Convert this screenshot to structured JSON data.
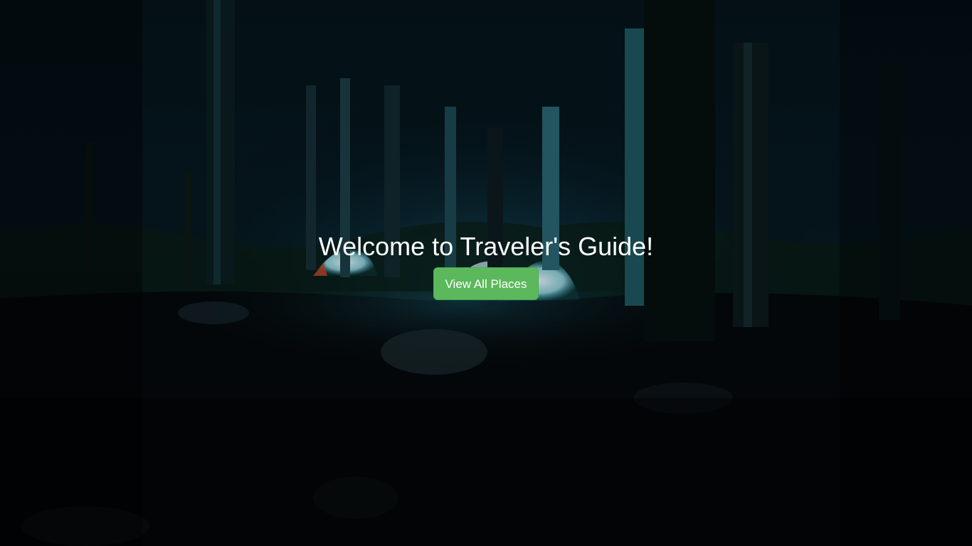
{
  "hero": {
    "background_image": "night-forest-camp-tents",
    "title": "Welcome to Traveler's Guide!",
    "cta_label": "View All Places"
  },
  "colors": {
    "button_bg": "#5cb85c",
    "button_border": "#4cae4c",
    "title_text": "#ffffff"
  }
}
